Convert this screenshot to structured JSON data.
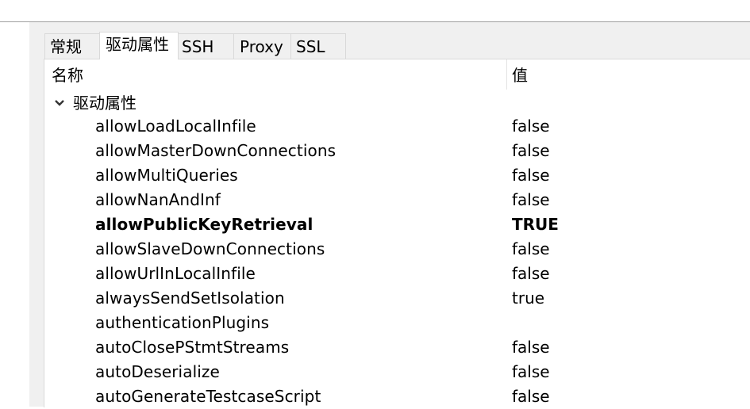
{
  "tabs": [
    {
      "label": "常规",
      "active": false
    },
    {
      "label": "驱动属性",
      "active": true
    },
    {
      "label": "SSH",
      "active": false
    },
    {
      "label": "Proxy",
      "active": false
    },
    {
      "label": "SSL",
      "active": false
    }
  ],
  "table": {
    "columns": {
      "name": "名称",
      "value": "值"
    },
    "group": {
      "label": "驱动属性",
      "expanded": true,
      "icon": "chevron-down-icon"
    },
    "rows": [
      {
        "name": "allowLoadLocalInfile",
        "value": "false",
        "bold": false
      },
      {
        "name": "allowMasterDownConnections",
        "value": "false",
        "bold": false
      },
      {
        "name": "allowMultiQueries",
        "value": "false",
        "bold": false
      },
      {
        "name": "allowNanAndInf",
        "value": "false",
        "bold": false
      },
      {
        "name": "allowPublicKeyRetrieval",
        "value": "TRUE",
        "bold": true
      },
      {
        "name": "allowSlaveDownConnections",
        "value": "false",
        "bold": false
      },
      {
        "name": "allowUrlInLocalInfile",
        "value": "false",
        "bold": false
      },
      {
        "name": "alwaysSendSetIsolation",
        "value": "true",
        "bold": false
      },
      {
        "name": "authenticationPlugins",
        "value": "",
        "bold": false
      },
      {
        "name": "autoClosePStmtStreams",
        "value": "false",
        "bold": false
      },
      {
        "name": "autoDeserialize",
        "value": "false",
        "bold": false
      },
      {
        "name": "autoGenerateTestcaseScript",
        "value": "false",
        "bold": false
      }
    ]
  }
}
